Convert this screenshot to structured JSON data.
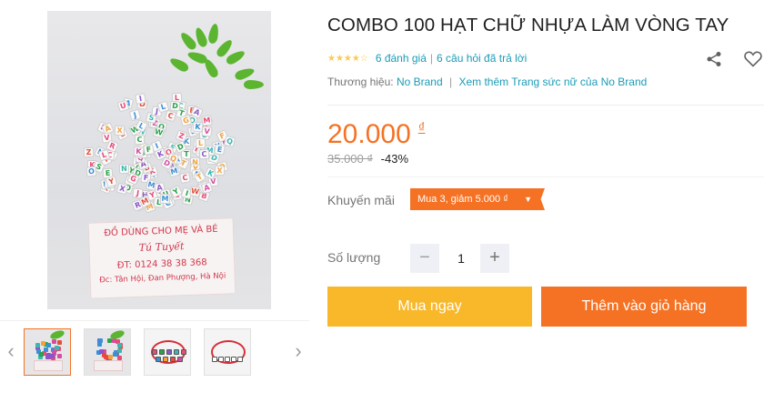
{
  "product": {
    "title": "COMBO 100 HẠT CHỮ NHỰA LÀM VÒNG TAY",
    "rating_stars": "★★★★☆",
    "rating_value": 3.5,
    "reviews_link": "6 đánh giá",
    "questions_link": "6 câu hỏi đã trả lời",
    "brand_label": "Thương hiệu:",
    "brand_name": "No Brand",
    "more_from_brand": "Xem thêm Trang sức nữ của No Brand",
    "price": "20.000",
    "currency": "₫",
    "old_price": "35.000 ₫",
    "discount": "-43%"
  },
  "promotion": {
    "label": "Khuyến mãi",
    "tag": "Mua 3, giảm 5.000 ₫"
  },
  "quantity": {
    "label": "Số lượng",
    "value": "1",
    "minus": "−",
    "plus": "+"
  },
  "buttons": {
    "buy_now": "Mua ngay",
    "add_to_cart": "Thêm vào giỏ hàng"
  },
  "icons": {
    "share": "share-icon",
    "wishlist": "heart-icon",
    "prev": "chevron-left-icon",
    "next": "chevron-right-icon",
    "dropdown": "caret-down-icon"
  },
  "image_card": {
    "line1": "ĐỒ DÙNG CHO MẸ VÀ BÉ",
    "line2": "Tú Tuyết",
    "line3": "ĐT: 0124 38 38 368",
    "line4": "Đc: Tân Hội, Đan Phượng, Hà Nội"
  },
  "colors": {
    "accent": "#f57224",
    "buy_now": "#f8b82a",
    "link": "#1a9cb7",
    "star": "#faca51"
  }
}
